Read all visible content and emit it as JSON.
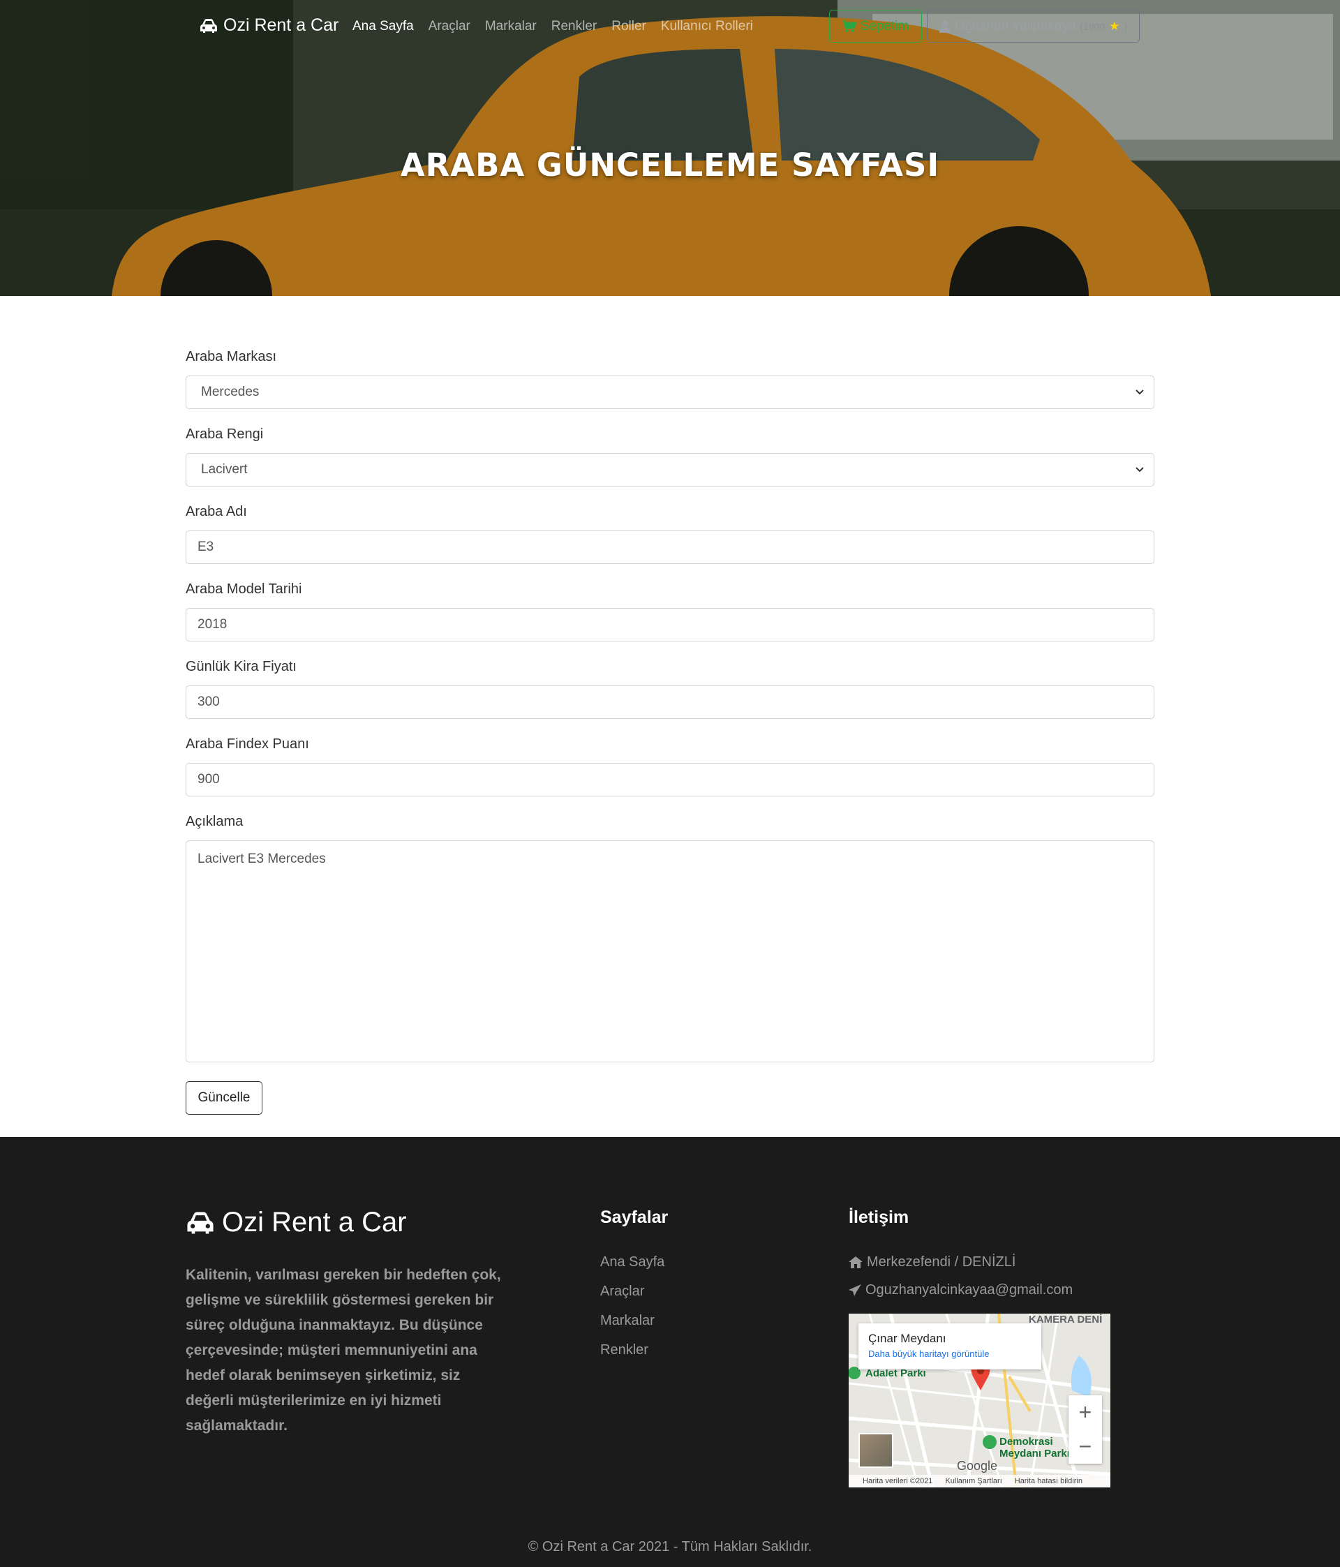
{
  "nav": {
    "brand": "Ozi Rent a Car",
    "links": [
      "Ana Sayfa",
      "Araçlar",
      "Markalar",
      "Renkler",
      "Roller",
      "Kullanıcı Rolleri"
    ],
    "cart": "Sepetim",
    "user": "Oğuzhan Yalçınkaya",
    "score": "(1900"
  },
  "hero": {
    "title": "ARABA GÜNCELLEME SAYFASI"
  },
  "form": {
    "brand_label": "Araba Markası",
    "brand_value": "Mercedes",
    "color_label": "Araba Rengi",
    "color_value": "Lacivert",
    "name_label": "Araba Adı",
    "name_value": "E3",
    "model_label": "Araba Model Tarihi",
    "model_value": "2018",
    "price_label": "Günlük Kira Fiyatı",
    "price_value": "300",
    "findex_label": "Araba Findex Puanı",
    "findex_value": "900",
    "desc_label": "Açıklama",
    "desc_value": "Lacivert E3 Mercedes",
    "submit": "Güncelle"
  },
  "footer": {
    "brand": "Ozi Rent a Car",
    "about": "Kalitenin, varılması gereken bir hedeften çok, gelişme ve süreklilik göstermesi gereken bir süreç olduğuna inanmaktayız. Bu düşünce çerçevesinde; müşteri memnuniyetini ana hedef olarak benimseyen şirketimiz, siz değerli müşterilerimize en iyi hizmeti sağlamaktadır.",
    "pages_title": "Sayfalar",
    "pages": [
      "Ana Sayfa",
      "Araçlar",
      "Markalar",
      "Renkler"
    ],
    "contact_title": "İletişim",
    "address": "Merkezefendi / DENİZLİ",
    "email": "Oguzhanyalcinkayaa@gmail.com",
    "map_place": "Çınar Meydanı",
    "map_link": "Daha büyük haritayı görüntüle",
    "map_park1": "Adalet Parkı",
    "map_park2": "Demokrasi Meydanı Parkı",
    "map_label": "KAMERA DENİ",
    "map_google": "Google",
    "map_footer": [
      "Harita verileri ©2021",
      "Kullanım Şartları",
      "Harita hatası bildirin"
    ],
    "copyright": "© Ozi Rent a Car 2021 - Tüm Hakları Saklıdır."
  },
  "colors": {
    "success": "#28a745",
    "footer_bg": "#1b1b1b",
    "car": "#d4891e"
  }
}
